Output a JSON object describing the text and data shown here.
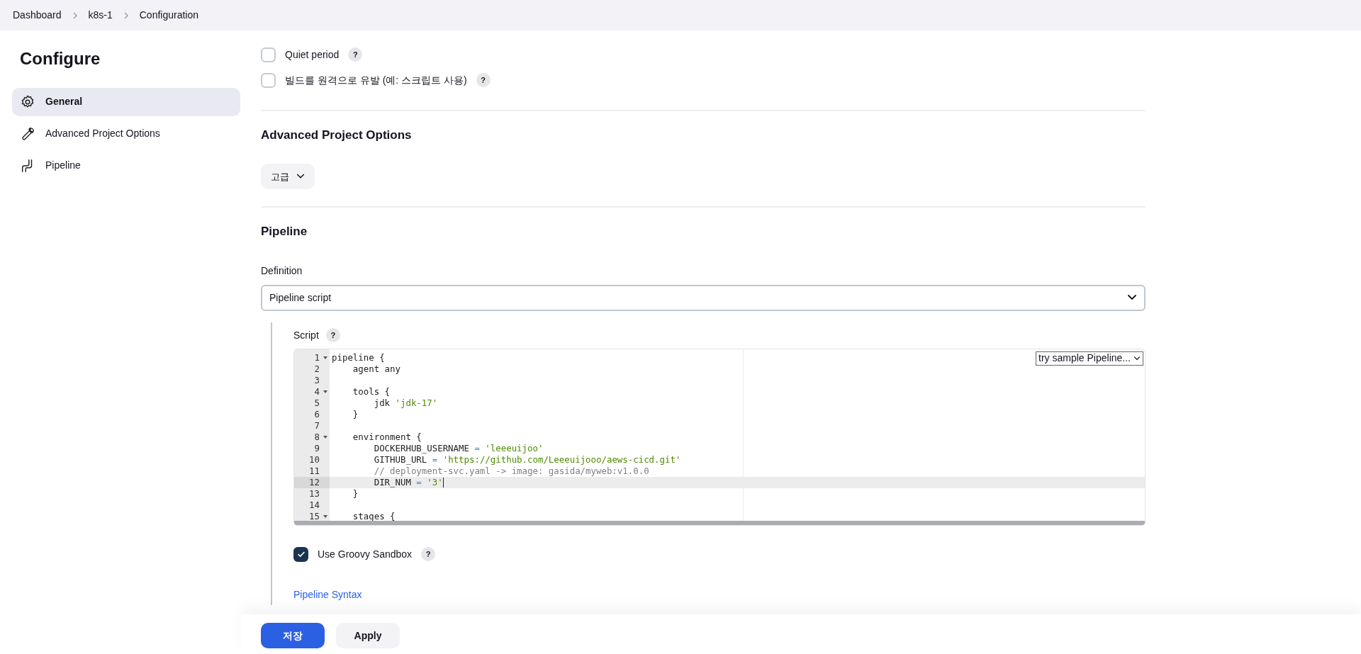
{
  "breadcrumb": [
    {
      "label": "Dashboard"
    },
    {
      "label": "k8s-1"
    },
    {
      "label": "Configuration"
    }
  ],
  "sidebar": {
    "title": "Configure",
    "items": [
      {
        "label": "General",
        "selected": true
      },
      {
        "label": "Advanced Project Options",
        "selected": false
      },
      {
        "label": "Pipeline",
        "selected": false
      }
    ]
  },
  "general_options": [
    {
      "label": "Quiet period",
      "checked": false,
      "help": "?"
    },
    {
      "label": "빌드를 원격으로 유발 (예: 스크립트 사용)",
      "checked": false,
      "help": "?"
    }
  ],
  "advanced_section": {
    "title": "Advanced Project Options",
    "button": "고급"
  },
  "pipeline_section": {
    "title": "Pipeline",
    "definition_label": "Definition",
    "definition_value": "Pipeline script",
    "script_label": "Script",
    "script_help": "?",
    "sample_dropdown": "try sample Pipeline...",
    "code": [
      {
        "number": "1",
        "foldable": true,
        "current": false,
        "tokens": [
          {
            "text": "pipeline {",
            "kind": "plain"
          }
        ]
      },
      {
        "number": "2",
        "foldable": false,
        "current": false,
        "tokens": [
          {
            "text": "    agent any",
            "kind": "plain"
          }
        ]
      },
      {
        "number": "3",
        "foldable": false,
        "current": false
      },
      {
        "number": "4",
        "foldable": true,
        "current": false,
        "tokens": [
          {
            "text": "    tools {",
            "kind": "plain"
          }
        ]
      },
      {
        "number": "5",
        "foldable": false,
        "current": false,
        "tokens": [
          {
            "text": "        jdk ",
            "kind": "plain"
          },
          {
            "text": "'jdk-17'",
            "kind": "string"
          }
        ]
      },
      {
        "number": "6",
        "foldable": false,
        "current": false,
        "tokens": [
          {
            "text": "    }",
            "kind": "plain"
          }
        ]
      },
      {
        "number": "7",
        "foldable": false,
        "current": false
      },
      {
        "number": "8",
        "foldable": true,
        "current": false,
        "tokens": [
          {
            "text": "    environment {",
            "kind": "plain"
          }
        ]
      },
      {
        "number": "9",
        "foldable": false,
        "current": false,
        "tokens": [
          {
            "text": "        DOCKERHUB_USERNAME",
            "kind": "plain"
          },
          {
            "text": " = ",
            "kind": "operator"
          },
          {
            "text": "'leeeuijoo'",
            "kind": "string"
          }
        ]
      },
      {
        "number": "10",
        "foldable": false,
        "current": false,
        "tokens": [
          {
            "text": "        GITHUB_URL",
            "kind": "plain"
          },
          {
            "text": " = ",
            "kind": "operator"
          },
          {
            "text": "'https://github.com/Leeeuijooo/aews-cicd.git'",
            "kind": "string"
          }
        ]
      },
      {
        "number": "11",
        "foldable": false,
        "current": false,
        "tokens": [
          {
            "text": "        // deployment-svc.yaml -> image: gasida/myweb:v1.0.0",
            "kind": "comment"
          }
        ]
      },
      {
        "number": "12",
        "foldable": false,
        "current": true,
        "tokens": [
          {
            "text": "        DIR_NUM",
            "kind": "plain"
          },
          {
            "text": " = ",
            "kind": "operator"
          },
          {
            "text": "'3'",
            "kind": "string"
          }
        ]
      },
      {
        "number": "13",
        "foldable": false,
        "current": false,
        "tokens": [
          {
            "text": "    }",
            "kind": "plain"
          }
        ]
      },
      {
        "number": "14",
        "foldable": false,
        "current": false
      },
      {
        "number": "15",
        "foldable": true,
        "current": false,
        "tokens": [
          {
            "text": "    stages {",
            "kind": "plain"
          }
        ]
      }
    ],
    "sandbox": {
      "label": "Use Groovy Sandbox",
      "checked": true,
      "help": "?"
    },
    "syntax_link": "Pipeline Syntax"
  },
  "footer_buttons": [
    {
      "label": "저장",
      "kind": "primary"
    },
    {
      "label": "Apply",
      "kind": "secondary"
    }
  ]
}
